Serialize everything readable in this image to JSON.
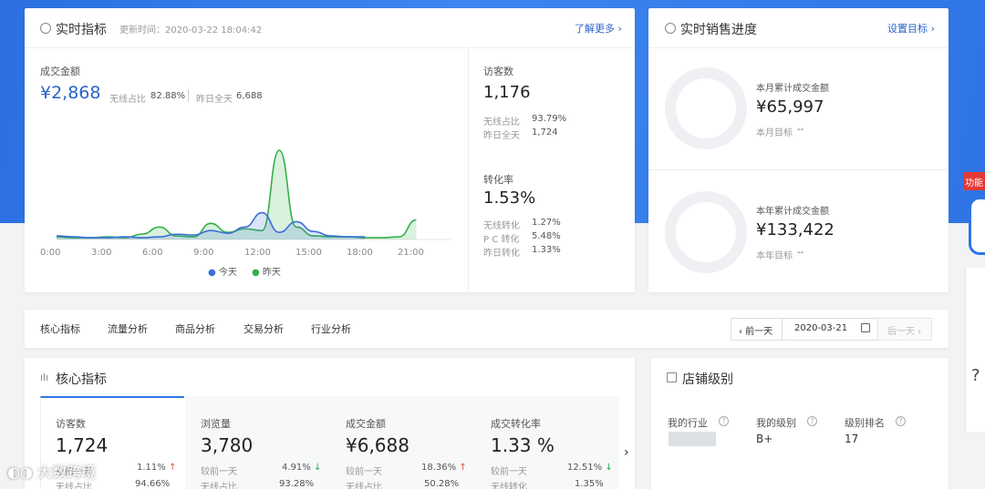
{
  "realtime": {
    "title": "实时指标",
    "updated_label": "更新时间：2020-03-22 18:04:42",
    "more_link": "了解更多 ›",
    "gmv_label": "成交金额",
    "gmv_value": "¥2,868",
    "wireless_ratio_label": "无线占比",
    "wireless_ratio_value": "82.88%",
    "yesterday_label": "昨日全天",
    "yesterday_value": "6,688",
    "legend_today": "今天",
    "legend_yesterday": "昨天",
    "visitors_label": "访客数",
    "visitors_value": "1,176",
    "visitors_wireless_label": "无线占比",
    "visitors_wireless_value": "93.79%",
    "visitors_yesterday_label": "昨日全天",
    "visitors_yesterday_value": "1,724",
    "conv_label": "转化率",
    "conv_value": "1.53%",
    "conv_wireless_label": "无线转化",
    "conv_wireless_value": "1.27%",
    "conv_pc_label": "P C 转化",
    "conv_pc_value": "5.48%",
    "conv_yesterday_label": "昨日转化",
    "conv_yesterday_value": "1.33%"
  },
  "sales_progress": {
    "title": "实时销售进度",
    "settings_link": "设置目标 ›",
    "month_label": "本月累计成交金额",
    "month_value": "¥65,997",
    "month_target_label": "本月目标",
    "month_target_value": "--",
    "year_label": "本年累计成交金额",
    "year_value": "¥133,422",
    "year_target_label": "本年目标",
    "year_target_value": "--"
  },
  "tabs": [
    "核心指标",
    "流量分析",
    "商品分析",
    "交易分析",
    "行业分析"
  ],
  "date_nav": {
    "prev": "‹ 前一天",
    "date": "2020-03-21",
    "next": "后一天 ›"
  },
  "core": {
    "title": "核心指标",
    "kpis": [
      {
        "label": "访客数",
        "value": "1,724",
        "cmp_label": "较前一天",
        "cmp_value": "1.11%",
        "dir": "up",
        "sub_label": "无线占比",
        "sub_value": "94.66%"
      },
      {
        "label": "浏览量",
        "value": "3,780",
        "cmp_label": "较前一天",
        "cmp_value": "4.91%",
        "dir": "down",
        "sub_label": "无线占比",
        "sub_value": "93.28%"
      },
      {
        "label": "成交金额",
        "value": "¥6,688",
        "cmp_label": "较前一天",
        "cmp_value": "18.36%",
        "dir": "up",
        "sub_label": "无线占比",
        "sub_value": "50.28%"
      },
      {
        "label": "成交转化率",
        "value": "1.33 %",
        "cmp_label": "较前一天",
        "cmp_value": "12.51%",
        "dir": "down",
        "sub_label": "无线转化",
        "sub_value": "1.35%"
      }
    ]
  },
  "shop_level": {
    "title": "店铺级别",
    "industry_label": "我的行业",
    "level_label": "我的级别",
    "level_value": "B+",
    "rank_label": "级别排名",
    "rank_value": "17"
  },
  "side": {
    "badge": "功能",
    "q": "?"
  },
  "brand": {
    "text": "大数跨境"
  },
  "chart_data": {
    "type": "area",
    "x": [
      "0:00",
      "3:00",
      "6:00",
      "9:00",
      "12:00",
      "15:00",
      "18:00",
      "21:00"
    ],
    "series": [
      {
        "name": "今天",
        "color": "#3a6fd8",
        "values": [
          4,
          3,
          2,
          2,
          3,
          2,
          3,
          6,
          5,
          10,
          7,
          14,
          30,
          8,
          20,
          9,
          4,
          3,
          3
        ]
      },
      {
        "name": "昨天",
        "color": "#33b04a",
        "values": [
          3,
          2,
          2,
          3,
          2,
          6,
          14,
          4,
          3,
          18,
          8,
          12,
          10,
          100,
          14,
          4,
          3,
          3,
          2,
          2,
          3,
          22
        ]
      }
    ]
  }
}
